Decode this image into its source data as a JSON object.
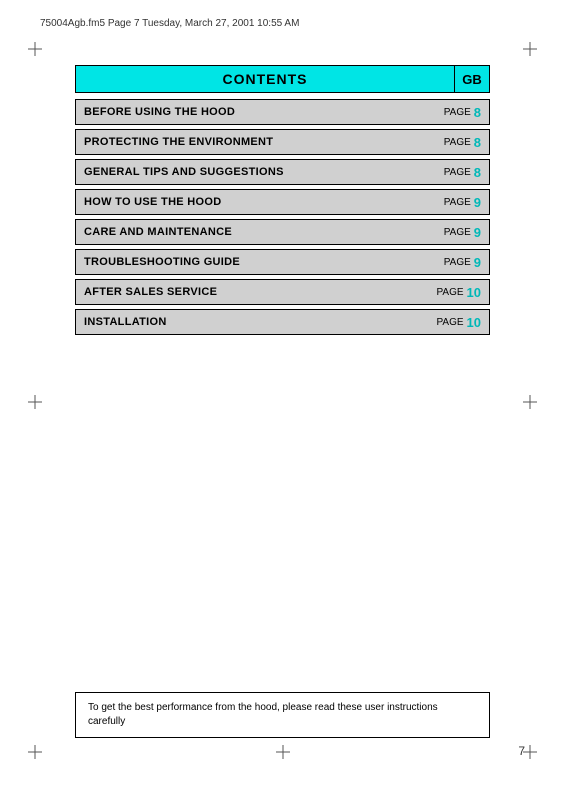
{
  "header": {
    "file_info": "75004Agb.fm5  Page 7  Tuesday, March 27, 2001  10:55 AM"
  },
  "contents": {
    "title": "CONTENTS",
    "gb_label": "GB",
    "rows": [
      {
        "label": "BEFORE USING THE HOOD",
        "page_word": "PAGE",
        "page_num": "8"
      },
      {
        "label": "PROTECTING THE ENVIRONMENT",
        "page_word": "PAGE",
        "page_num": "8"
      },
      {
        "label": "GENERAL TIPS AND SUGGESTIONS",
        "page_word": "PAGE",
        "page_num": "8"
      },
      {
        "label": "HOW TO USE THE HOOD",
        "page_word": "PAGE",
        "page_num": "9"
      },
      {
        "label": "CARE AND MAINTENANCE",
        "page_word": "PAGE",
        "page_num": "9"
      },
      {
        "label": "TROUBLESHOOTING GUIDE",
        "page_word": "PAGE",
        "page_num": "9"
      },
      {
        "label": "AFTER SALES SERVICE",
        "page_word": "PAGE",
        "page_num": "10"
      },
      {
        "label": "INSTALLATION",
        "page_word": "PAGE",
        "page_num": "10"
      }
    ]
  },
  "notice": {
    "text": "To get the best performance from the hood, please read these user instructions carefully"
  },
  "page_number": "7"
}
